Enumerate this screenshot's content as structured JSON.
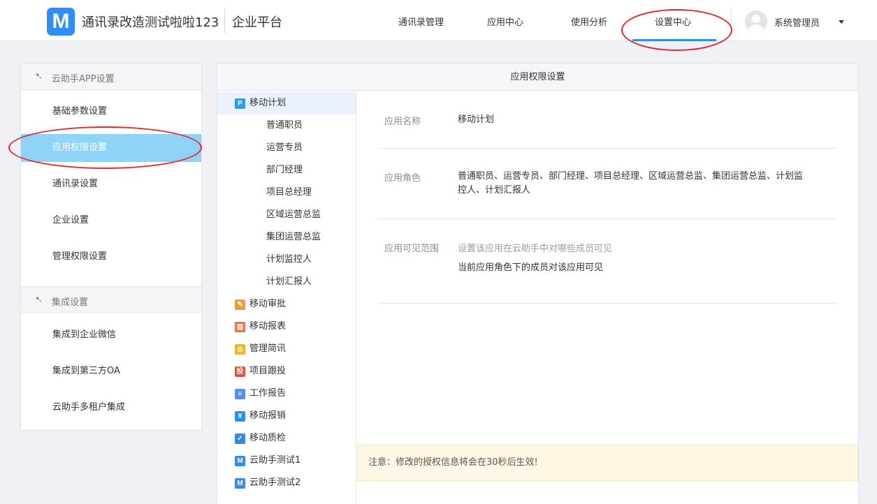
{
  "header": {
    "logo_letter": "M",
    "company_name": "通讯录改造测试啦啦123",
    "platform": "企业平台",
    "nav": [
      "通讯录管理",
      "应用中心",
      "使用分析",
      "设置中心"
    ],
    "active_nav": "设置中心",
    "user_name": "系统管理员",
    "accent_color": "#2d8ef7",
    "highlight_color": "#e5262c"
  },
  "sidebar": {
    "sections": [
      {
        "title": "云助手APP设置",
        "icon": "collapse-arrow-icon",
        "items": [
          "基础参数设置",
          "应用权限设置",
          "通讯录设置",
          "企业设置",
          "管理权限设置"
        ]
      },
      {
        "title": "集成设置",
        "icon": "collapse-arrow-icon",
        "items": [
          "集成到企业微信",
          "集成到第三方OA",
          "云助手多租户集成"
        ]
      }
    ],
    "active_item": "应用权限设置",
    "active_color": "#8fd3f7"
  },
  "main": {
    "title": "应用权限设置",
    "tree": {
      "apps": [
        {
          "label": "移动计划",
          "icon": "P",
          "color": "#2d9cf0",
          "selected": true
        },
        {
          "label": "移动审批",
          "icon": "✎",
          "color": "#f59a3b"
        },
        {
          "label": "移动报表",
          "icon": "▥",
          "color": "#f0734a"
        },
        {
          "label": "管理简讯",
          "icon": "◎",
          "color": "#f5b21c"
        },
        {
          "label": "项目跟投",
          "icon": "投",
          "color": "#ea4d3d"
        },
        {
          "label": "工作报告",
          "icon": "≡",
          "color": "#5b8ef0"
        },
        {
          "label": "移动报销",
          "icon": "¥",
          "color": "#2d8ef7"
        },
        {
          "label": "移动质检",
          "icon": "✓",
          "color": "#3a86e0"
        },
        {
          "label": "云助手测试1",
          "icon": "M",
          "color": "#2d8ef7"
        },
        {
          "label": "云助手测试2",
          "icon": "M",
          "color": "#2d8ef7"
        }
      ],
      "roles": [
        "普通职员",
        "运营专员",
        "部门经理",
        "项目总经理",
        "区域运营总监",
        "集团运营总监",
        "计划监控人",
        "计划汇报人"
      ]
    },
    "detail": {
      "name_label": "应用名称",
      "name_value": "移动计划",
      "role_label": "应用角色",
      "role_value_line1": "普通职员、运营专员、部门经理、项目总经理、区域运营总监、集团运营总监、计划监",
      "role_value_line2": "控人、计划汇报人",
      "scope_label": "应用可见范围",
      "scope_hint": "设置该应用在云助手中对哪些成员可见",
      "scope_value": "当前应用角色下的成员对该应用可见"
    },
    "notice": "注意：修改的授权信息将会在30秒后生效!"
  }
}
